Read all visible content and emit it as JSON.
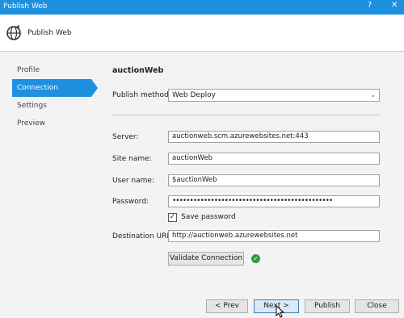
{
  "window": {
    "title": "Publish Web",
    "help_glyph": "?",
    "close_glyph": "✕"
  },
  "header": {
    "title": "Publish Web",
    "icon": "globe-publish-icon"
  },
  "sidebar": {
    "items": [
      {
        "label": "Profile"
      },
      {
        "label": "Connection"
      },
      {
        "label": "Settings"
      },
      {
        "label": "Preview"
      }
    ],
    "active_index": 1
  },
  "main": {
    "profile_name": "auctionWeb",
    "publish_method_label": "Publish method:",
    "publish_method_value": "Web Deploy",
    "server_label": "Server:",
    "server_value": "auctionweb.scm.azurewebsites.net:443",
    "site_name_label": "Site name:",
    "site_name_value": "auctionWeb",
    "user_name_label": "User name:",
    "user_name_value": "$auctionWeb",
    "password_label": "Password:",
    "password_value": "••••••••••••••••••••••••••••••••••••••••••••••",
    "save_password_label": "Save password",
    "save_password_checked": true,
    "destination_url_label": "Destination URL:",
    "destination_url_value": "http://auctionweb.azurewebsites.net",
    "validate_label": "Validate Connection",
    "validate_status_icon": "check-circle-icon"
  },
  "footer": {
    "prev_label": "< Prev",
    "next_label": "Next >",
    "publish_label": "Publish",
    "close_label": "Close"
  },
  "colors": {
    "accent": "#1e90e0",
    "success": "#2e9c3c"
  }
}
